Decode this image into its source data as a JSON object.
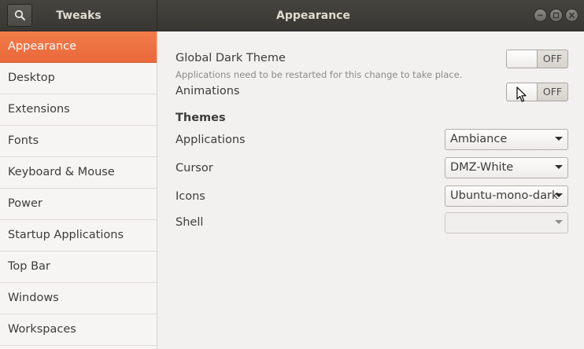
{
  "titlebar": {
    "app_title": "Tweaks",
    "page_title": "Appearance"
  },
  "sidebar": {
    "items": [
      {
        "label": "Appearance",
        "active": true
      },
      {
        "label": "Desktop"
      },
      {
        "label": "Extensions"
      },
      {
        "label": "Fonts"
      },
      {
        "label": "Keyboard & Mouse"
      },
      {
        "label": "Power"
      },
      {
        "label": "Startup Applications"
      },
      {
        "label": "Top Bar"
      },
      {
        "label": "Windows"
      },
      {
        "label": "Workspaces"
      }
    ]
  },
  "appearance": {
    "global_dark_theme": {
      "label": "Global Dark Theme",
      "sublabel": "Applications need to be restarted for this change to take place.",
      "state": "OFF"
    },
    "animations": {
      "label": "Animations",
      "state": "OFF"
    },
    "themes_heading": "Themes",
    "applications": {
      "label": "Applications",
      "value": "Ambiance"
    },
    "cursor": {
      "label": "Cursor",
      "value": "DMZ-White"
    },
    "icons": {
      "label": "Icons",
      "value": "Ubuntu-mono-dark"
    },
    "shell": {
      "label": "Shell",
      "value": ""
    }
  },
  "icons": {
    "search": "search-icon",
    "minimize": "minimize-icon",
    "maximize": "maximize-icon",
    "close": "close-icon",
    "pointer": "mouse-pointer-icon"
  },
  "colors": {
    "accent": "#e9683a",
    "titlebar": "#3c3b37"
  }
}
